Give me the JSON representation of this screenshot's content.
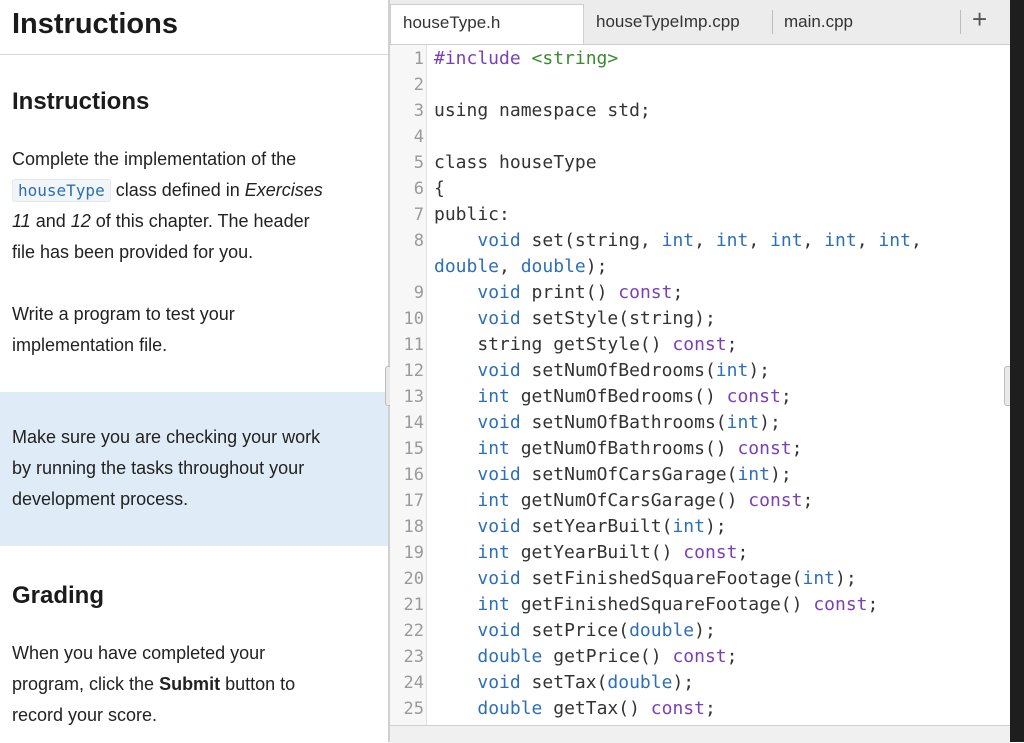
{
  "left": {
    "header_title": "Instructions",
    "section1_title": "Instructions",
    "para1": {
      "t1": "Complete the implementation of the",
      "chip": "houseType",
      "t2": " class defined in ",
      "em1": "Exercises",
      "em2": "11",
      "t3": " and ",
      "em3": "12",
      "t4": " of this chapter. The header",
      "t5": "file has been provided for you."
    },
    "para2_l1": "Write a program to test your",
    "para2_l2": "implementation file.",
    "note_l1": "Make sure you are checking your work",
    "note_l2": "by running the tasks throughout your",
    "note_l3": "development process.",
    "section2_title": "Grading",
    "grading_l1": "When you have completed your",
    "grading_l2a": "program, click the ",
    "grading_bold": "Submit",
    "grading_l2b": " button to",
    "grading_l3": "record your score."
  },
  "editor": {
    "tabs": [
      "houseType.h",
      "houseTypeImp.cpp",
      "main.cpp"
    ],
    "add_tab": "+",
    "lines": [
      {
        "n": "1",
        "tokens": [
          [
            "kw",
            "#include"
          ],
          [
            "",
            ""
          ],
          [
            "str",
            " <string>"
          ]
        ]
      },
      {
        "n": "2",
        "tokens": []
      },
      {
        "n": "3",
        "tokens": [
          [
            "",
            "using namespace std;"
          ]
        ]
      },
      {
        "n": "4",
        "tokens": []
      },
      {
        "n": "5",
        "tokens": [
          [
            "",
            "class houseType"
          ]
        ]
      },
      {
        "n": "6",
        "tokens": [
          [
            "",
            "{"
          ]
        ]
      },
      {
        "n": "7",
        "tokens": [
          [
            "",
            "public:"
          ]
        ]
      },
      {
        "n": "8",
        "tokens": [
          [
            "",
            "    "
          ],
          [
            "ty",
            "void"
          ],
          [
            "",
            " set(string, "
          ],
          [
            "ty",
            "int"
          ],
          [
            "",
            ", "
          ],
          [
            "ty",
            "int"
          ],
          [
            "",
            ", "
          ],
          [
            "ty",
            "int"
          ],
          [
            "",
            ", "
          ],
          [
            "ty",
            "int"
          ],
          [
            "",
            ", "
          ],
          [
            "ty",
            "int"
          ],
          [
            "",
            ","
          ]
        ]
      },
      {
        "n": "",
        "tokens": [
          [
            "ty",
            "double"
          ],
          [
            "",
            ", "
          ],
          [
            "ty",
            "double"
          ],
          [
            "",
            ");"
          ]
        ]
      },
      {
        "n": "9",
        "tokens": [
          [
            "",
            "    "
          ],
          [
            "ty",
            "void"
          ],
          [
            "",
            " print() "
          ],
          [
            "kw",
            "const"
          ],
          [
            "",
            ";"
          ]
        ]
      },
      {
        "n": "10",
        "tokens": [
          [
            "",
            "    "
          ],
          [
            "ty",
            "void"
          ],
          [
            "",
            " setStyle(string);"
          ]
        ]
      },
      {
        "n": "11",
        "tokens": [
          [
            "",
            "    string getStyle() "
          ],
          [
            "kw",
            "const"
          ],
          [
            "",
            ";"
          ]
        ]
      },
      {
        "n": "12",
        "tokens": [
          [
            "",
            "    "
          ],
          [
            "ty",
            "void"
          ],
          [
            "",
            " setNumOfBedrooms("
          ],
          [
            "ty",
            "int"
          ],
          [
            "",
            ");"
          ]
        ]
      },
      {
        "n": "13",
        "tokens": [
          [
            "",
            "    "
          ],
          [
            "ty",
            "int"
          ],
          [
            "",
            " getNumOfBedrooms() "
          ],
          [
            "kw",
            "const"
          ],
          [
            "",
            ";"
          ]
        ]
      },
      {
        "n": "14",
        "tokens": [
          [
            "",
            "    "
          ],
          [
            "ty",
            "void"
          ],
          [
            "",
            " setNumOfBathrooms("
          ],
          [
            "ty",
            "int"
          ],
          [
            "",
            ");"
          ]
        ]
      },
      {
        "n": "15",
        "tokens": [
          [
            "",
            "    "
          ],
          [
            "ty",
            "int"
          ],
          [
            "",
            " getNumOfBathrooms() "
          ],
          [
            "kw",
            "const"
          ],
          [
            "",
            ";"
          ]
        ]
      },
      {
        "n": "16",
        "tokens": [
          [
            "",
            "    "
          ],
          [
            "ty",
            "void"
          ],
          [
            "",
            " setNumOfCarsGarage("
          ],
          [
            "ty",
            "int"
          ],
          [
            "",
            ");"
          ]
        ]
      },
      {
        "n": "17",
        "tokens": [
          [
            "",
            "    "
          ],
          [
            "ty",
            "int"
          ],
          [
            "",
            " getNumOfCarsGarage() "
          ],
          [
            "kw",
            "const"
          ],
          [
            "",
            ";"
          ]
        ]
      },
      {
        "n": "18",
        "tokens": [
          [
            "",
            "    "
          ],
          [
            "ty",
            "void"
          ],
          [
            "",
            " setYearBuilt("
          ],
          [
            "ty",
            "int"
          ],
          [
            "",
            ");"
          ]
        ]
      },
      {
        "n": "19",
        "tokens": [
          [
            "",
            "    "
          ],
          [
            "ty",
            "int"
          ],
          [
            "",
            " getYearBuilt() "
          ],
          [
            "kw",
            "const"
          ],
          [
            "",
            ";"
          ]
        ]
      },
      {
        "n": "20",
        "tokens": [
          [
            "",
            "    "
          ],
          [
            "ty",
            "void"
          ],
          [
            "",
            " setFinishedSquareFootage("
          ],
          [
            "ty",
            "int"
          ],
          [
            "",
            ");"
          ]
        ]
      },
      {
        "n": "21",
        "tokens": [
          [
            "",
            "    "
          ],
          [
            "ty",
            "int"
          ],
          [
            "",
            " getFinishedSquareFootage() "
          ],
          [
            "kw",
            "const"
          ],
          [
            "",
            ";"
          ]
        ]
      },
      {
        "n": "22",
        "tokens": [
          [
            "",
            "    "
          ],
          [
            "ty",
            "void"
          ],
          [
            "",
            " setPrice("
          ],
          [
            "ty",
            "double"
          ],
          [
            "",
            ");"
          ]
        ]
      },
      {
        "n": "23",
        "tokens": [
          [
            "",
            "    "
          ],
          [
            "ty",
            "double"
          ],
          [
            "",
            " getPrice() "
          ],
          [
            "kw",
            "const"
          ],
          [
            "",
            ";"
          ]
        ]
      },
      {
        "n": "24",
        "tokens": [
          [
            "",
            "    "
          ],
          [
            "ty",
            "void"
          ],
          [
            "",
            " setTax("
          ],
          [
            "ty",
            "double"
          ],
          [
            "",
            ");"
          ]
        ]
      },
      {
        "n": "25",
        "tokens": [
          [
            "",
            "    "
          ],
          [
            "ty",
            "double"
          ],
          [
            "",
            " getTax() "
          ],
          [
            "kw",
            "const"
          ],
          [
            "",
            ";"
          ]
        ]
      }
    ]
  }
}
